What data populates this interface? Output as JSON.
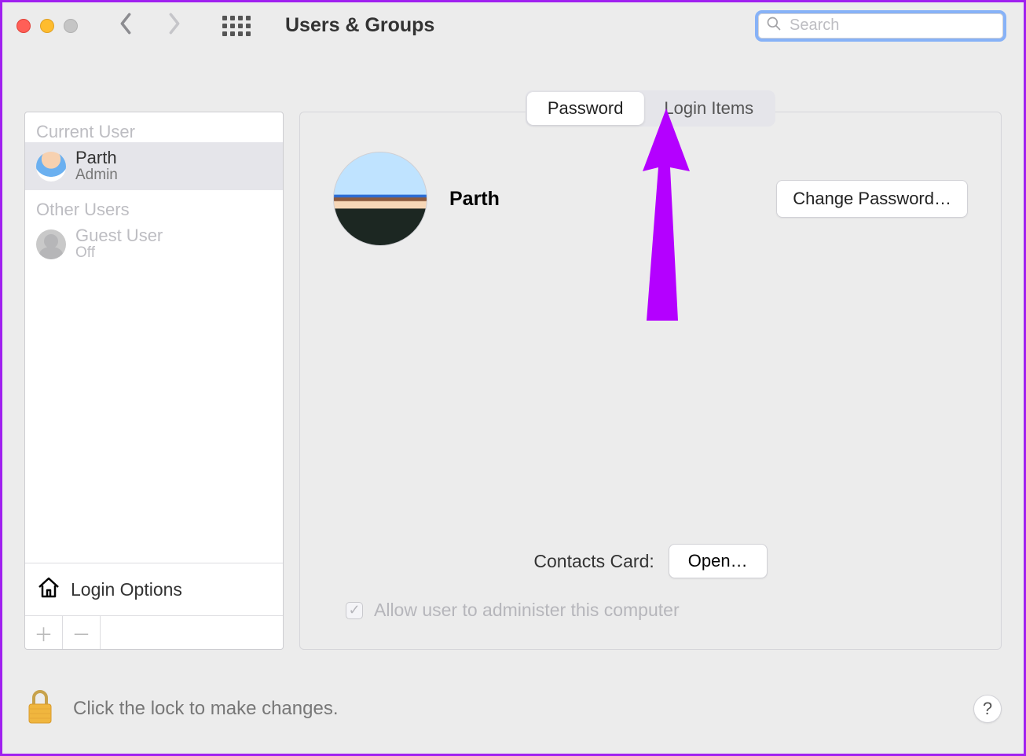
{
  "header": {
    "title": "Users & Groups",
    "search_placeholder": "Search"
  },
  "sidebar": {
    "current_user_heading": "Current User",
    "other_users_heading": "Other Users",
    "users": [
      {
        "name": "Parth",
        "role": "Admin"
      },
      {
        "name": "Guest User",
        "role": "Off"
      }
    ],
    "login_options_label": "Login Options"
  },
  "tabs": {
    "password": "Password",
    "login_items": "Login Items"
  },
  "profile": {
    "name": "Parth",
    "change_password_label": "Change Password…"
  },
  "contacts": {
    "label": "Contacts Card:",
    "open_label": "Open…"
  },
  "admin_checkbox_label": "Allow user to administer this computer",
  "footer": {
    "lock_text": "Click the lock to make changes.",
    "help_label": "?"
  }
}
